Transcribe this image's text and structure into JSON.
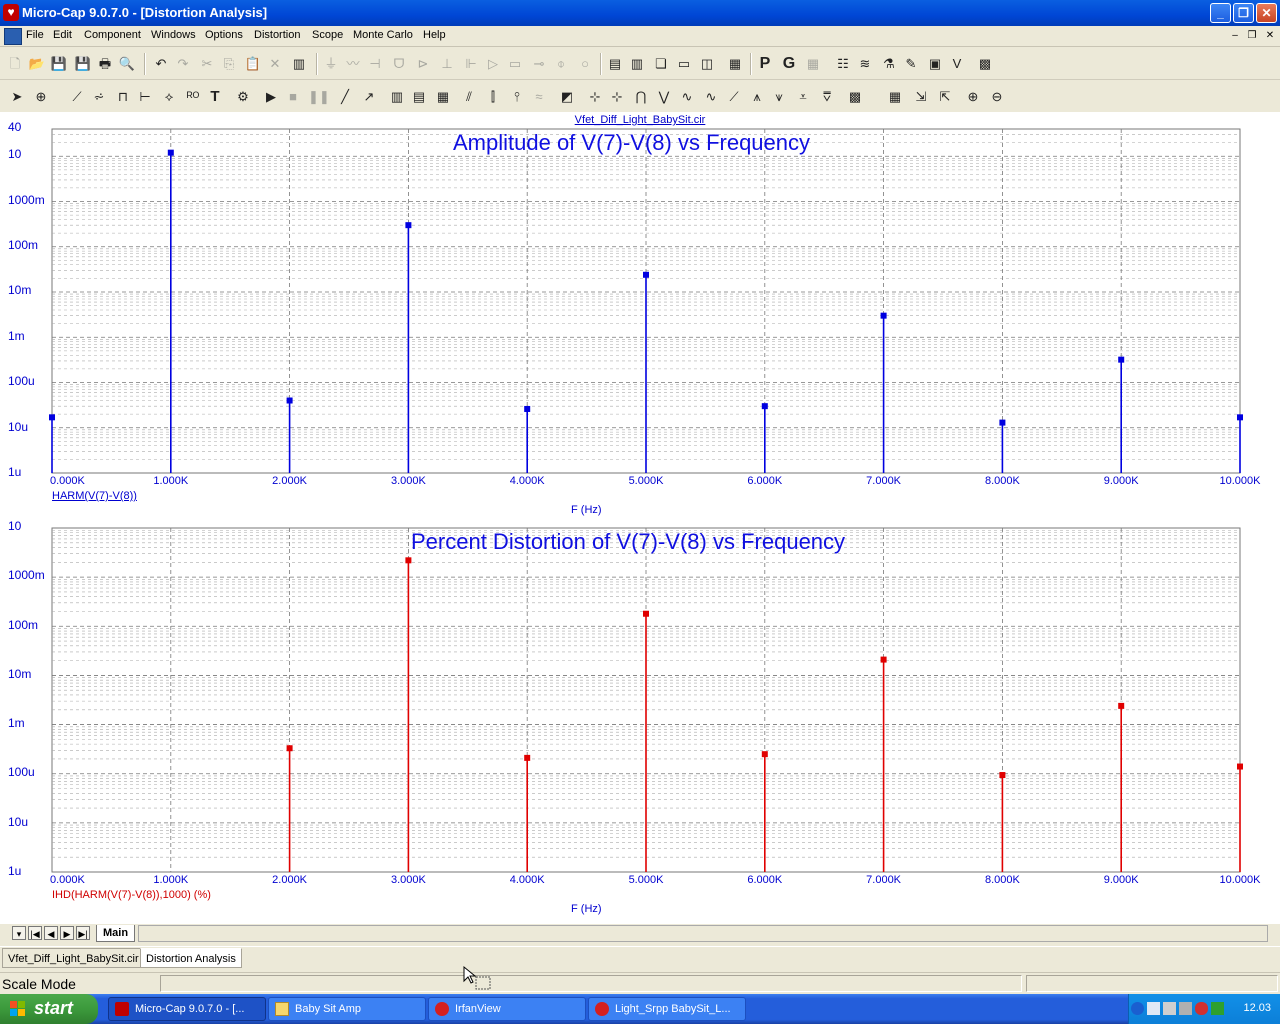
{
  "window": {
    "title": "Micro-Cap 9.0.7.0 - [Distortion Analysis]",
    "minimize": "_",
    "restore": "❐",
    "close": "✕"
  },
  "menu": {
    "items": [
      "File",
      "Edit",
      "Component",
      "Windows",
      "Options",
      "Distortion",
      "Scope",
      "Monte Carlo",
      "Help"
    ],
    "mdi_min": "–",
    "mdi_restore": "❐",
    "mdi_close": "✕"
  },
  "plot_window": {
    "filename": "Vfet_Diff_Light_BabySit.cir"
  },
  "colors": {
    "amplitude_trace": "#0000e0",
    "distortion_trace": "#e00000",
    "grid": "#8c8c8c",
    "label_blue": "#0000d0",
    "label_red": "#d00000"
  },
  "chart_data": [
    {
      "type": "bar",
      "title": "Amplitude of V(7)-V(8) vs Frequency",
      "xlabel": "F (Hz)",
      "ylabel": "",
      "series": [
        {
          "name": "HARM(V(7)-V(8))",
          "x": [
            0,
            1000,
            2000,
            3000,
            4000,
            5000,
            6000,
            7000,
            8000,
            9000,
            10000
          ],
          "values": [
            1.7e-05,
            12.0,
            4e-05,
            0.3,
            2.6e-05,
            0.024,
            3e-05,
            0.003,
            1.3e-05,
            0.00032,
            1.7e-05
          ]
        }
      ],
      "xlim": [
        0,
        10000
      ],
      "ylim": [
        1e-06,
        40
      ],
      "yscale": "log",
      "x_ticks": [
        "0.000K",
        "1.000K",
        "2.000K",
        "3.000K",
        "4.000K",
        "5.000K",
        "6.000K",
        "7.000K",
        "8.000K",
        "9.000K",
        "10.000K"
      ],
      "y_ticks": [
        "40",
        "10",
        "1000m",
        "100m",
        "10m",
        "1m",
        "100u",
        "10u",
        "1u"
      ],
      "grid": true
    },
    {
      "type": "bar",
      "title": "Percent Distortion of V(7)-V(8) vs Frequency",
      "xlabel": "F (Hz)",
      "ylabel": "",
      "series": [
        {
          "name": "IHD(HARM(V(7)-V(8)),1000) (%)",
          "x": [
            2000,
            3000,
            4000,
            5000,
            6000,
            7000,
            8000,
            9000,
            10000
          ],
          "values": [
            0.00033,
            2.2,
            0.00021,
            0.18,
            0.00025,
            0.021,
            9.4e-05,
            0.0024,
            0.00014
          ]
        }
      ],
      "xlim": [
        0,
        10000
      ],
      "ylim": [
        1e-06,
        10
      ],
      "yscale": "log",
      "x_ticks": [
        "0.000K",
        "1.000K",
        "2.000K",
        "3.000K",
        "4.000K",
        "5.000K",
        "6.000K",
        "7.000K",
        "8.000K",
        "9.000K",
        "10.000K"
      ],
      "y_ticks": [
        "10",
        "1000m",
        "100m",
        "10m",
        "1m",
        "100u",
        "10u",
        "1u"
      ],
      "grid": true
    }
  ],
  "sheet_tabs": {
    "main": "Main"
  },
  "doc_tabs": [
    "Vfet_Diff_Light_BabySit.cir",
    "Distortion Analysis"
  ],
  "status": {
    "mode": "Scale Mode"
  },
  "taskbar": {
    "start": "start",
    "tasks": [
      "Micro-Cap 9.0.7.0 - [...",
      "Baby Sit Amp",
      "IrfanView",
      "Light_Srpp BabySit_L..."
    ],
    "clock": "12.03"
  }
}
